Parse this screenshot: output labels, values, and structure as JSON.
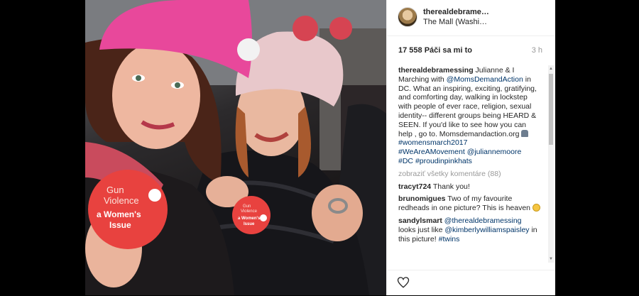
{
  "header": {
    "username": "therealdebrame…",
    "location": "The Mall (Washi…"
  },
  "stats": {
    "likes": "17 558 Páči sa mi to",
    "time": "3 h"
  },
  "caption": {
    "user": "therealdebramessing",
    "text_1": " Julianne & I Marching with ",
    "mention": "@MomsDemandAction",
    "text_2": " in DC. What an inspiring, exciting, gratifying, and comforting day, walking in lockstep with people of ever race, religion, sexual identity-- different groups being HEARD & SEEN. If you'd like to see how you can help , go to. Momsdemandaction.org ",
    "hashtags": [
      "#womensmarch2017",
      "#WeAreAMovement",
      "@juliannemoore",
      "#DC",
      "#proudinpinkhats"
    ]
  },
  "view_all": "zobraziť všetky komentáre (88)",
  "comments": [
    {
      "user": "tracyt724",
      "text": " Thank you!"
    },
    {
      "user": "brunomigues",
      "text": " Two of my favourite redheads in one picture? This is heaven "
    },
    {
      "user": "sandylsmart",
      "mention": "@therealdebramessing",
      "text_a": " looks just like ",
      "mention_b": "@kimberlywilliamspaisley",
      "text_b": " in this picture! ",
      "tag": "#twins"
    }
  ],
  "photo": {
    "button_left_line1": "Gun",
    "button_left_line2": "Violence",
    "button_left_line3": "a Women's",
    "button_left_line4": "Issue",
    "button_right_line1": "Gun",
    "button_right_line2": "Violence",
    "button_right_line3": "a Women's",
    "button_right_line4": "Issue"
  },
  "icons": {
    "like": "heart-outline-icon",
    "emoji_caption": "people-emoji-icon",
    "emoji_comment": "smiley-emoji-icon"
  },
  "colors": {
    "link": "#003569",
    "username": "#262626",
    "muted": "#999999",
    "pink_hat": "#e8489b",
    "button_red": "#e8423f"
  }
}
